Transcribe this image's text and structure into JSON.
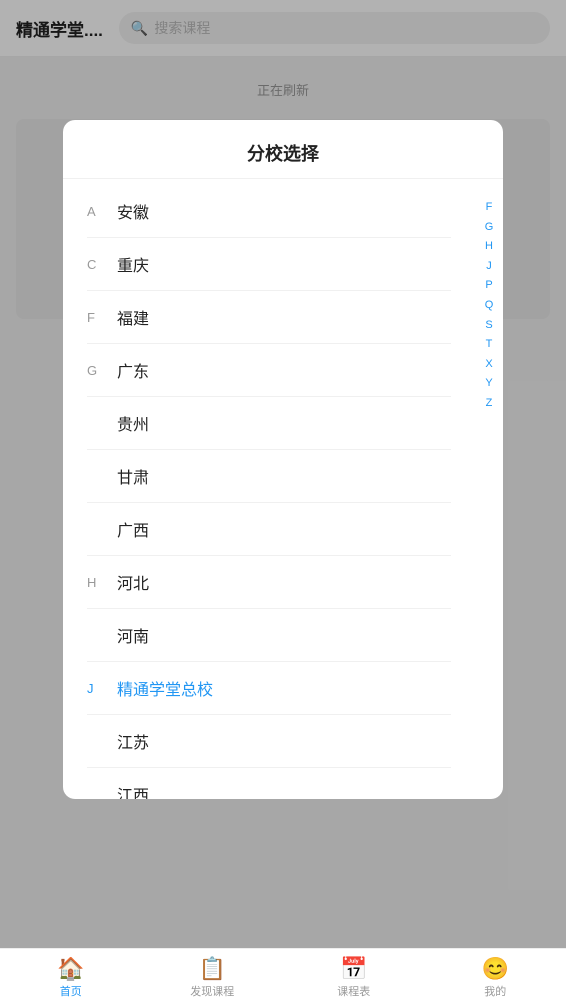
{
  "header": {
    "title": "精通学堂....",
    "search_placeholder": "搜索课程"
  },
  "refresh_text": "正在刷新",
  "modal": {
    "title": "分校选择",
    "items": [
      {
        "letter": "A",
        "label": "安徽",
        "highlight": false
      },
      {
        "letter": "C",
        "label": "重庆",
        "highlight": false
      },
      {
        "letter": "F",
        "label": "福建",
        "highlight": false
      },
      {
        "letter": "G",
        "label": "广东",
        "highlight": false
      },
      {
        "letter": "",
        "label": "贵州",
        "highlight": false
      },
      {
        "letter": "",
        "label": "甘肃",
        "highlight": false
      },
      {
        "letter": "",
        "label": "广西",
        "highlight": false
      },
      {
        "letter": "H",
        "label": "河北",
        "highlight": false
      },
      {
        "letter": "",
        "label": "河南",
        "highlight": false
      },
      {
        "letter": "J",
        "label": "精通学堂总校",
        "highlight": true
      },
      {
        "letter": "",
        "label": "江苏",
        "highlight": false
      },
      {
        "letter": "",
        "label": "江西",
        "highlight": false
      }
    ],
    "side_index": [
      "F",
      "G",
      "H",
      "J",
      "P",
      "Q",
      "S",
      "T",
      "X",
      "Y",
      "Z"
    ]
  },
  "bottom_nav": {
    "items": [
      {
        "id": "home",
        "label": "首页",
        "icon": "🏠",
        "active": true
      },
      {
        "id": "discover",
        "label": "发现课程",
        "icon": "📋",
        "active": false
      },
      {
        "id": "schedule",
        "label": "课程表",
        "icon": "📅",
        "active": false
      },
      {
        "id": "mine",
        "label": "我的",
        "icon": "😊",
        "active": false
      }
    ]
  }
}
